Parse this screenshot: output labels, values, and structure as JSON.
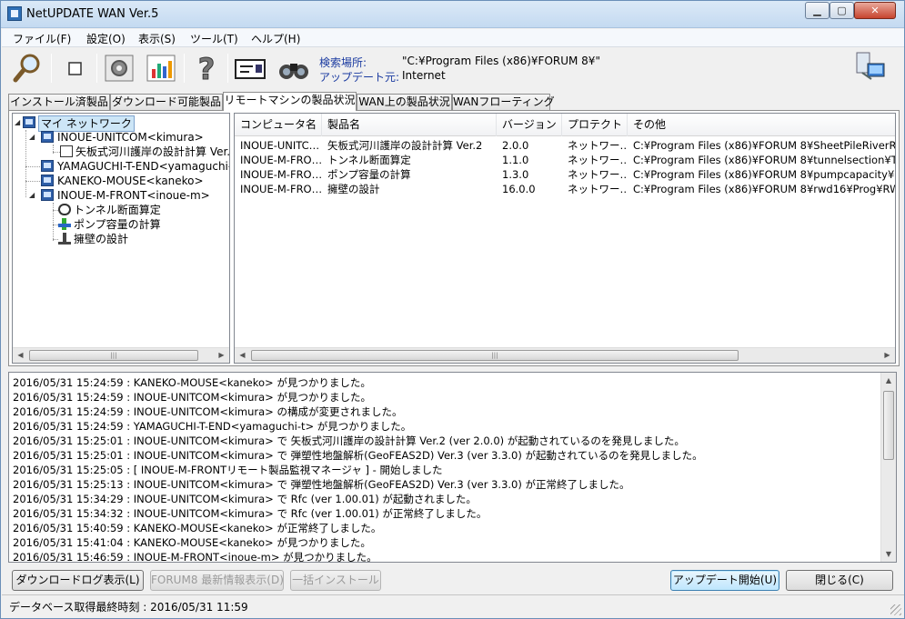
{
  "window": {
    "title": "NetUPDATE WAN Ver.5",
    "caption_min": "▁",
    "caption_max": "▢",
    "caption_close": "✕"
  },
  "menu": [
    "ファイル(F)",
    "設定(O)",
    "表示(S)",
    "ツール(T)",
    "ヘルプ(H)"
  ],
  "toolbar": {
    "icons": [
      "search-icon",
      "stop-icon",
      "settings-icon",
      "chart-icon",
      "help-icon",
      "card-icon",
      "binoculars-icon",
      "network-status-icon"
    ],
    "search_location_label": "検索場所:",
    "search_location_value": "\"C:¥Program Files (x86)¥FORUM 8¥\"",
    "update_source_label": "アップデート元:",
    "update_source_value": "Internet"
  },
  "tabs": [
    {
      "label": "インストール済製品",
      "active": false
    },
    {
      "label": "ダウンロード可能製品",
      "active": false
    },
    {
      "label": "リモートマシンの製品状況",
      "active": true
    },
    {
      "label": "WAN上の製品状況",
      "active": false
    },
    {
      "label": "WANフローティング",
      "active": false
    }
  ],
  "tree": {
    "root": "マイ ネットワーク",
    "nodes": [
      {
        "label": "INOUE-UNITCOM<kimura>",
        "children": [
          "矢板式河川護岸の設計計算 Ver."
        ]
      },
      {
        "label": "YAMAGUCHI-T-END<yamaguchi-t>",
        "children": []
      },
      {
        "label": "KANEKO-MOUSE<kaneko>",
        "children": []
      },
      {
        "label": "INOUE-M-FRONT<inoue-m>",
        "children": [
          "トンネル断面算定",
          "ポンプ容量の計算",
          "擁壁の設計"
        ]
      }
    ]
  },
  "products_table": {
    "columns": [
      "コンピュータ名",
      "製品名",
      "バージョン",
      "プロテクト",
      "その他"
    ],
    "rows": [
      [
        "INOUE-UNITC…",
        "矢板式河川護岸の設計計算 Ver.2",
        "2.0.0",
        "ネットワー…",
        "C:¥Program Files (x86)¥FORUM 8¥SheetPileRiverRevet"
      ],
      [
        "INOUE-M-FRO…",
        "トンネル断面算定",
        "1.1.0",
        "ネットワー…",
        "C:¥Program Files (x86)¥FORUM 8¥tunnelsection¥Tunne"
      ],
      [
        "INOUE-M-FRO…",
        "ポンプ容量の計算",
        "1.3.0",
        "ネットワー…",
        "C:¥Program Files (x86)¥FORUM 8¥pumpcapacity¥PumpC"
      ],
      [
        "INOUE-M-FRO…",
        "擁壁の設計",
        "16.0.0",
        "ネットワー…",
        "C:¥Program Files (x86)¥FORUM 8¥rwd16¥Prog¥RWD16.e"
      ]
    ]
  },
  "log": [
    "2016/05/31 15:24:59 : KANEKO-MOUSE<kaneko> が見つかりました。",
    "2016/05/31 15:24:59 : INOUE-UNITCOM<kimura> が見つかりました。",
    "2016/05/31 15:24:59 : INOUE-UNITCOM<kimura> の構成が変更されました。",
    "2016/05/31 15:24:59 : YAMAGUCHI-T-END<yamaguchi-t> が見つかりました。",
    "2016/05/31 15:25:01 : INOUE-UNITCOM<kimura> で 矢板式河川護岸の設計計算 Ver.2 (ver 2.0.0) が起動されているのを発見しました。",
    "2016/05/31 15:25:01 : INOUE-UNITCOM<kimura> で 弾塑性地盤解析(GeoFEAS2D) Ver.3 (ver 3.3.0) が起動されているのを発見しました。",
    "2016/05/31 15:25:05 : [ INOUE-M-FRONTリモート製品監視マネージャ ] - 開始しました",
    "2016/05/31 15:25:13 : INOUE-UNITCOM<kimura> で 弾塑性地盤解析(GeoFEAS2D) Ver.3 (ver 3.3.0) が正常終了しました。",
    "2016/05/31 15:34:29 : INOUE-UNITCOM<kimura> で Rfc (ver 1.00.01) が起動されました。",
    "2016/05/31 15:34:32 : INOUE-UNITCOM<kimura> で Rfc (ver 1.00.01) が正常終了しました。",
    "2016/05/31 15:40:59 : KANEKO-MOUSE<kaneko> が正常終了しました。",
    "2016/05/31 15:41:04 : KANEKO-MOUSE<kaneko> が見つかりました。",
    "2016/05/31 15:46:59 : INOUE-M-FRONT<inoue-m> が見つかりました。"
  ],
  "buttons": {
    "download_log": "ダウンロードログ表示(L)",
    "forum8_info": "FORUM8 最新情報表示(D)",
    "bulk_install": "一括インストール",
    "start_update": "アップデート開始(U)",
    "close": "閉じる(C)"
  },
  "status": {
    "label": "データベース取得最終時刻",
    "separator": " : ",
    "value": "2016/05/31 11:59"
  },
  "colors": {
    "accent_blue": "#1a3aa0",
    "selection": "#cde6f7",
    "focused_button": "#bee6fd"
  }
}
